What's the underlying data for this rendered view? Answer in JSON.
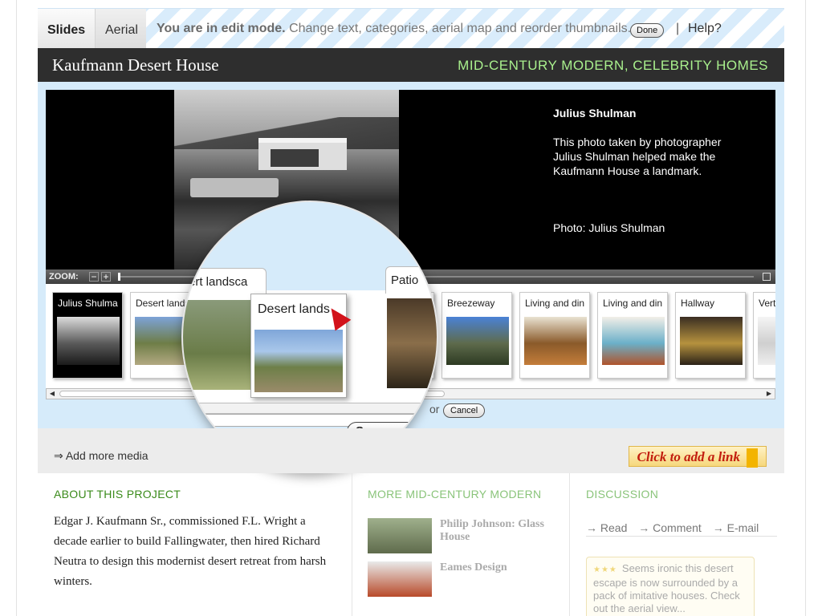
{
  "tabs": [
    {
      "label": "Slides",
      "active": true
    },
    {
      "label": "Aerial",
      "active": false
    }
  ],
  "edit_bar": {
    "mode_bold": "You are in edit mode.",
    "mode_text": " Change text, categories, aerial map and reorder thumbnails.",
    "done_label": "Done",
    "separator": "|",
    "help_label": "Help?"
  },
  "project": {
    "title": "Kaufmann Desert House",
    "categories": "MID-CENTURY MODERN, CELEBRITY HOMES"
  },
  "slide": {
    "caption_title": "Julius Shulman",
    "caption_body": "This photo taken by photographer Julius Shulman helped make the Kaufmann House a landmark.",
    "credit": "Photo: Julius Shulman"
  },
  "zoom": {
    "label": "ZOOM:",
    "minus": "−",
    "plus": "+"
  },
  "thumbnails": [
    {
      "label": "Julius Shulma",
      "selected": true,
      "colors": [
        "#dcdcdc",
        "#5a5a5a",
        "#1a1a1a"
      ]
    },
    {
      "label": "Desert lands",
      "selected": false,
      "colors": [
        "#7da3d8",
        "#6e7d47",
        "#b3a982"
      ]
    },
    {
      "label": "",
      "selected": false,
      "colors": [
        "#fff",
        "#fff",
        "#fff"
      ]
    },
    {
      "label": "",
      "selected": false,
      "colors": [
        "#fff",
        "#fff",
        "#fff"
      ]
    },
    {
      "label": "",
      "selected": false,
      "colors": [
        "#fff",
        "#fff",
        "#fff"
      ]
    },
    {
      "label": "Breezeway",
      "selected": false,
      "colors": [
        "#4a82d6",
        "#5e6b4c",
        "#2d3a22"
      ]
    },
    {
      "label": "Living and din",
      "selected": false,
      "colors": [
        "#e9e2d2",
        "#8a5a2a",
        "#c47d3a"
      ]
    },
    {
      "label": "Living and din",
      "selected": false,
      "colors": [
        "#f2efe8",
        "#6bb0c9",
        "#b0532b"
      ]
    },
    {
      "label": "Hallway",
      "selected": false,
      "colors": [
        "#3a2e22",
        "#b6923e",
        "#2a2218"
      ]
    },
    {
      "label": "Vert",
      "selected": false,
      "colors": [
        "#f5f5f5",
        "#cfcfcf",
        "#eeeeee"
      ]
    }
  ],
  "magnifier": {
    "tab_left": "ert landsca",
    "tab_right": "Patio",
    "card_label": "Desert lands",
    "save_label": "Save proj"
  },
  "form": {
    "or_text": "or",
    "cancel_label": "Cancel"
  },
  "media": {
    "add_media": "⇒ Add more media",
    "add_link": "Click to add a link"
  },
  "about": {
    "heading": "ABOUT THIS PROJECT",
    "text": "Edgar J. Kaufmann Sr., commissioned F.L. Wright a decade earlier to build Fallingwater, then hired Richard Neutra to design this modernist desert retreat from harsh winters."
  },
  "more": {
    "heading": "MORE MID-CENTURY MODERN",
    "items": [
      {
        "title": "Philip Johnson: Glass House",
        "colors": [
          "#9fb08c",
          "#5f6b4c"
        ]
      },
      {
        "title": "Eames Design",
        "colors": [
          "#e9eaea",
          "#b84a2a"
        ]
      }
    ]
  },
  "discussion": {
    "heading": "DISCUSSION",
    "links": [
      "→ Read",
      "→ Comment",
      "→ E-mail"
    ],
    "stars": "★★★",
    "comment": "Seems ironic this desert escape is now surrounded by a pack of imitative houses. Check out the aerial view..."
  }
}
